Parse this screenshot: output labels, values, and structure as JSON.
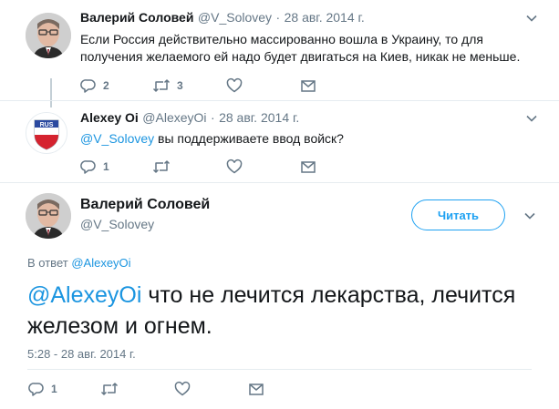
{
  "tweets": [
    {
      "name": "Валерий Соловей",
      "handle": "@V_Solovey",
      "sep": "·",
      "date": "28 авг. 2014 г.",
      "text_line1": "Если Россия действительно массированно вошла в Украину, то для",
      "text_line2": "получения желаемого ей  надо будет двигаться на Киев, никак не меньше.",
      "replies": "2",
      "retweets": "3"
    },
    {
      "name": "Alexey Oi",
      "handle": "@AlexeyOi",
      "sep": "·",
      "date": "28 авг. 2014 г.",
      "mention": "@V_Solovey",
      "text": " вы поддерживаете ввод войск?",
      "replies": "1",
      "avatar_label": "RUS"
    }
  ],
  "main_tweet": {
    "name": "Валерий Соловей",
    "handle": "@V_Solovey",
    "follow_label": "Читать",
    "reply_prefix": "В ответ",
    "reply_to": "@AlexeyOi",
    "mention": "@AlexeyOi",
    "text": " что не лечится лекарства, лечится железом и огнем.",
    "timestamp": "5:28 - 28 авг. 2014 г.",
    "replies": "1"
  },
  "icons": {
    "reply": "reply-icon",
    "retweet": "retweet-icon",
    "like": "heart-icon",
    "dm": "envelope-icon",
    "more": "chevron-down-icon"
  },
  "colors": {
    "accent": "#1da1f2",
    "mention": "#1b95e0",
    "muted": "#657786"
  }
}
